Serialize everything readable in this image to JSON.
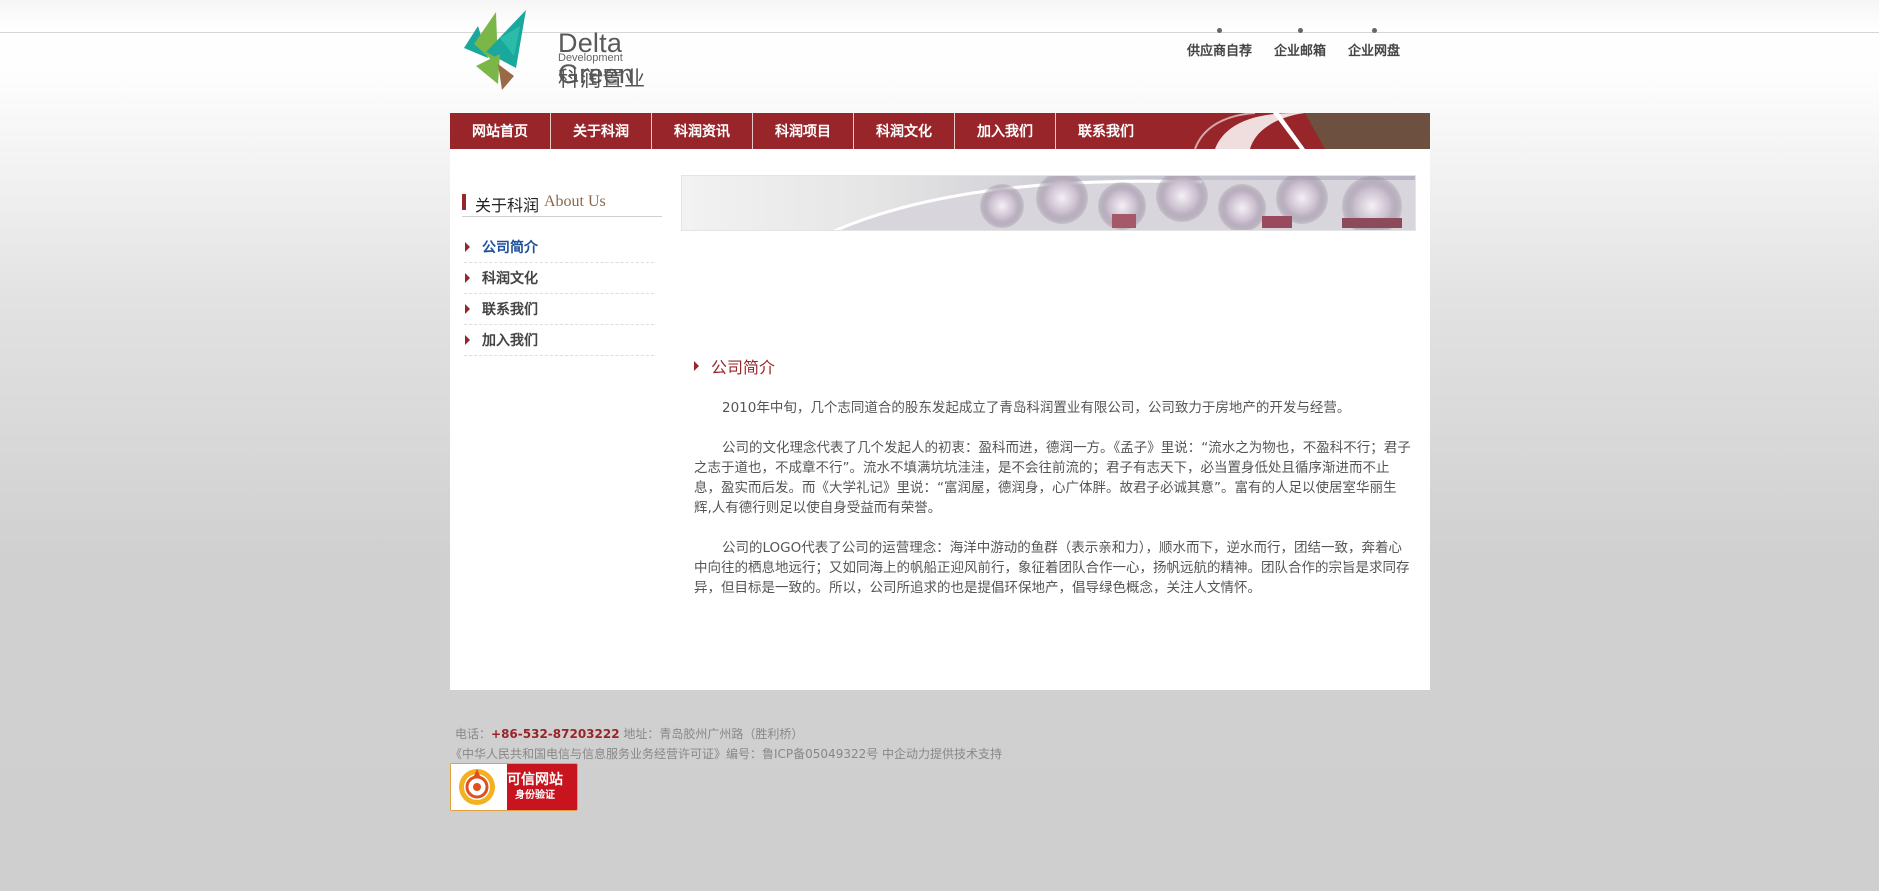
{
  "header": {
    "brand_en": "Delta Green",
    "brand_sub": "Development",
    "brand_cn": "科润置业",
    "top_links": [
      "供应商自荐",
      "企业邮箱",
      "企业网盘"
    ]
  },
  "nav": {
    "items": [
      "网站首页",
      "关于科润",
      "科润资讯",
      "科润项目",
      "科润文化",
      "加入我们",
      "联系我们"
    ]
  },
  "sidebar": {
    "title_cn": "关于科润",
    "title_en": "About Us",
    "items": [
      {
        "label": "公司简介",
        "active": true
      },
      {
        "label": "科润文化",
        "active": false
      },
      {
        "label": "联系我们",
        "active": false
      },
      {
        "label": "加入我们",
        "active": false
      }
    ]
  },
  "article": {
    "title": "公司简介",
    "paragraphs": [
      "2010年中旬，几个志同道合的股东发起成立了青岛科润置业有限公司，公司致力于房地产的开发与经营。",
      "公司的文化理念代表了几个发起人的初衷：盈科而进，德润一方。《孟子》里说：“流水之为物也，不盈科不行；君子之志于道也，不成章不行”。流水不填满坑坑洼洼，是不会往前流的；君子有志天下，必当置身低处且循序渐进而不止息，盈实而后发。而《大学礼记》里说：“富润屋，德润身，心广体胖。故君子必诚其意”。富有的人足以使居室华丽生辉,人有德行则足以使自身受益而有荣誉。",
      "公司的LOGO代表了公司的运营理念：海洋中游动的鱼群（表示亲和力），顺水而下，逆水而行，团结一致，奔着心中向往的栖息地远行；又如同海上的帆船正迎风前行，象征着团队合作一心，扬帆远航的精神。团队合作的宗旨是求同存异，但目标是一致的。所以，公司所追求的也是提倡环保地产，倡导绿色概念，关注人文情怀。"
    ]
  },
  "footer": {
    "phone_label": "电话：",
    "phone": "+86-532-87203222",
    "address": " 地址：青岛胶州广州路（胜利桥）",
    "license": "《中华人民共和国电信与信息服务业务经营许可证》编号：鲁ICP备05049322号 中企动力提供技术支持",
    "badge_title": "可信网站",
    "badge_sub": "身份验证"
  },
  "colors": {
    "brand_red": "#98252a",
    "active_link": "#1b4f9c",
    "logo_teal": "#1aa89c",
    "logo_green": "#7ab648",
    "logo_brown": "#9a6a46"
  }
}
